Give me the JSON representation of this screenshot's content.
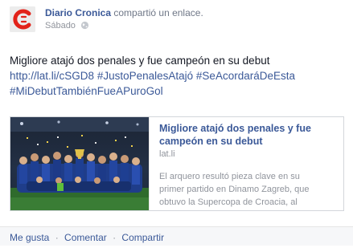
{
  "post": {
    "page_name": "Diario Cronica",
    "action_text": "compartió un enlace.",
    "timestamp": "Sábado",
    "message": {
      "text": "Migliore atajó dos penales y fue campeón en su debut",
      "url": "http://lat.li/cSGD8",
      "hashtags": [
        "#JustoPenalesAtajó",
        "#SeAcordaráDeEsta",
        "#MiDebutTambiénFueAPuroGol"
      ]
    }
  },
  "link_card": {
    "title_lines": [
      "Migliore atajó dos penales y fue",
      "campeón en su debut"
    ],
    "domain": "lat.li",
    "description_lines": [
      "El arquero resultó pieza clave en su",
      "primer partido en Dinamo Zagreb, que",
      "obtuvo la Supercopa de Croacia, al"
    ]
  },
  "actions": {
    "like": "Me gusta",
    "comment": "Comentar",
    "share": "Compartir",
    "separator": "·"
  },
  "colors": {
    "link": "#3b5998",
    "logo_red": "#e2231a",
    "muted": "#90949c"
  },
  "icons": {
    "avatar": "diario-cronica-logo",
    "privacy": "globe-icon"
  }
}
